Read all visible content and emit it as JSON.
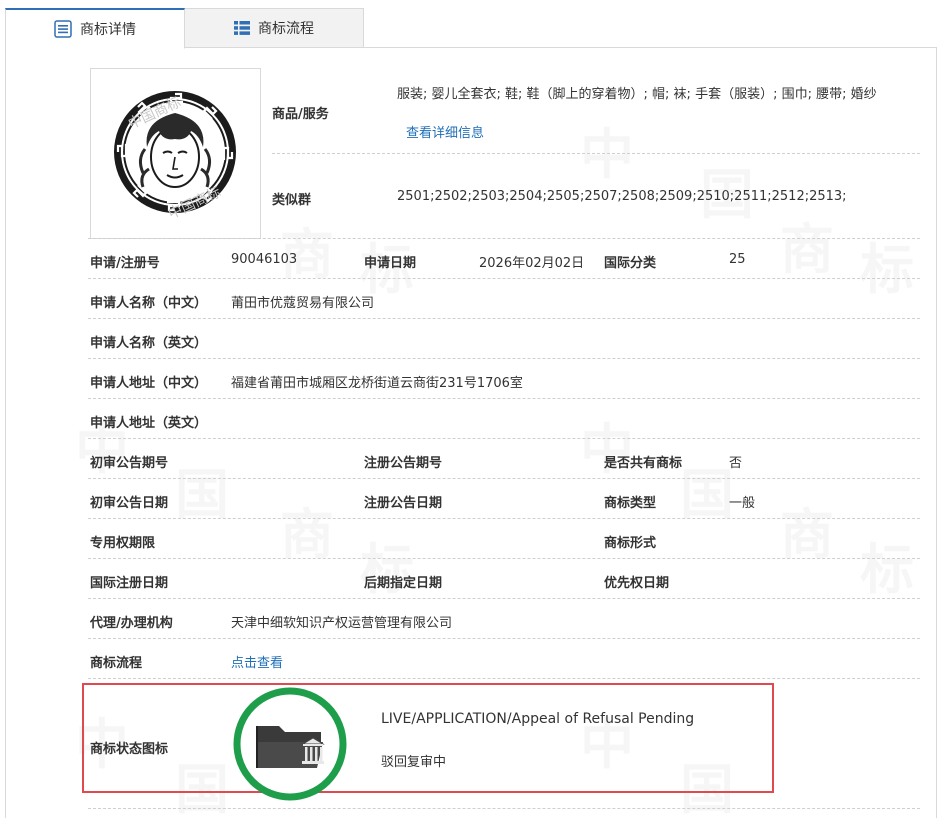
{
  "tabs": [
    {
      "label": "商标详情"
    },
    {
      "label": "商标流程"
    }
  ],
  "goods": {
    "label": "商品/服务",
    "value": "服装; 婴儿全套衣; 鞋; 鞋（脚上的穿着物）; 帽; 袜; 手套（服装）; 围巾; 腰带; 婚纱",
    "more_link": "查看详细信息"
  },
  "similar_group": {
    "label": "类似群",
    "value": "2501;2502;2503;2504;2505;2507;2508;2509;2510;2511;2512;2513;"
  },
  "fields": {
    "reg_no_label": "申请/注册号",
    "reg_no": "90046103",
    "apply_date_label": "申请日期",
    "apply_date": "2026年02月02日",
    "intl_class_label": "国际分类",
    "intl_class": "25",
    "applicant_cn_label": "申请人名称（中文）",
    "applicant_cn": "莆田市优蔻贸易有限公司",
    "applicant_en_label": "申请人名称（英文）",
    "address_cn_label": "申请人地址（中文）",
    "address_cn": "福建省莆田市城厢区龙桥街道云商街231号1706室",
    "address_en_label": "申请人地址（英文）",
    "prelim_no_label": "初审公告期号",
    "reg_pub_no_label": "注册公告期号",
    "shared_label": "是否共有商标",
    "shared": "否",
    "prelim_date_label": "初审公告日期",
    "reg_pub_date_label": "注册公告日期",
    "type_label": "商标类型",
    "type": "一般",
    "exclusive_label": "专用权期限",
    "form_label": "商标形式",
    "intl_reg_date_label": "国际注册日期",
    "later_date_label": "后期指定日期",
    "priority_date_label": "优先权日期",
    "agent_label": "代理/办理机构",
    "agent": "天津中细软知识产权运营管理有限公司",
    "flow_label": "商标流程",
    "flow_link": "点击查看"
  },
  "status": {
    "label": "商标状态图标",
    "en": "LIVE/APPLICATION/Appeal of Refusal Pending",
    "cn": "驳回复审中",
    "ring_color": "#1e9e4a",
    "icon": "folder-courthouse-icon"
  },
  "watermark": {
    "chars": [
      "中",
      "国",
      "商",
      "标"
    ]
  }
}
